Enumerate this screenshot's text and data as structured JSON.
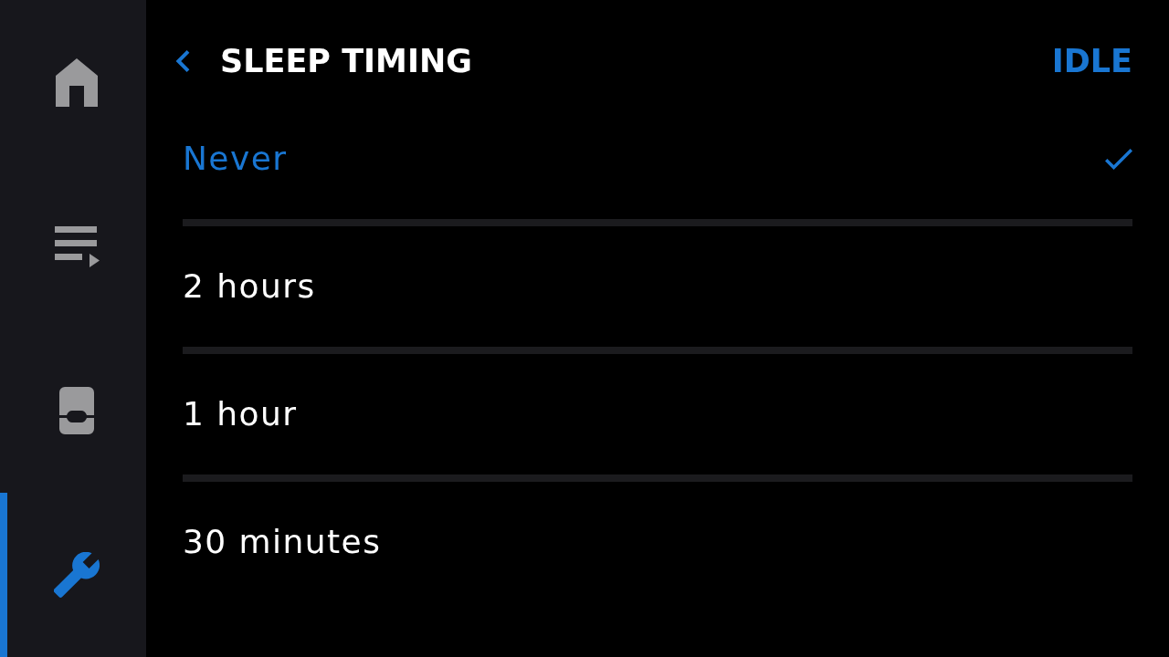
{
  "sidebar": {
    "items": [
      {
        "kind": "home",
        "selected": false
      },
      {
        "kind": "queue",
        "selected": false
      },
      {
        "kind": "device",
        "selected": false
      },
      {
        "kind": "settings",
        "selected": true
      }
    ]
  },
  "header": {
    "title": "SLEEP TIMING",
    "status": "IDLE"
  },
  "options": [
    {
      "label": "Never",
      "selected": true
    },
    {
      "label": "2 hours",
      "selected": false
    },
    {
      "label": "1 hour",
      "selected": false
    },
    {
      "label": "30 minutes",
      "selected": false
    }
  ]
}
